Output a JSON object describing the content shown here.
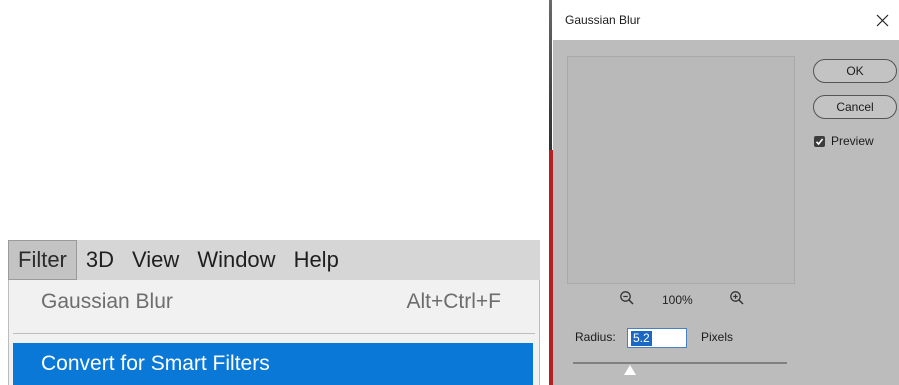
{
  "menubar": {
    "items": [
      {
        "label": "Filter",
        "active": true
      },
      {
        "label": "3D"
      },
      {
        "label": "View"
      },
      {
        "label": "Window"
      },
      {
        "label": "Help"
      }
    ]
  },
  "filter_menu": {
    "gaussian_blur": {
      "label": "Gaussian Blur",
      "shortcut": "Alt+Ctrl+F"
    },
    "convert_smart": {
      "label": "Convert for Smart Filters"
    }
  },
  "dialog": {
    "title": "Gaussian Blur",
    "ok_label": "OK",
    "cancel_label": "Cancel",
    "preview_label": "Preview",
    "preview_checked": true,
    "zoom_level": "100%",
    "radius_label": "Radius:",
    "radius_value": "5.2",
    "units_label": "Pixels"
  },
  "colors": {
    "menu_highlight": "#0a78d7",
    "dialog_bg": "#bcbcbc",
    "input_selection": "#1b67c4"
  },
  "icons": [
    "close-icon",
    "checkmark-icon",
    "zoom-out-icon",
    "zoom-in-icon",
    "slider-thumb-icon"
  ]
}
